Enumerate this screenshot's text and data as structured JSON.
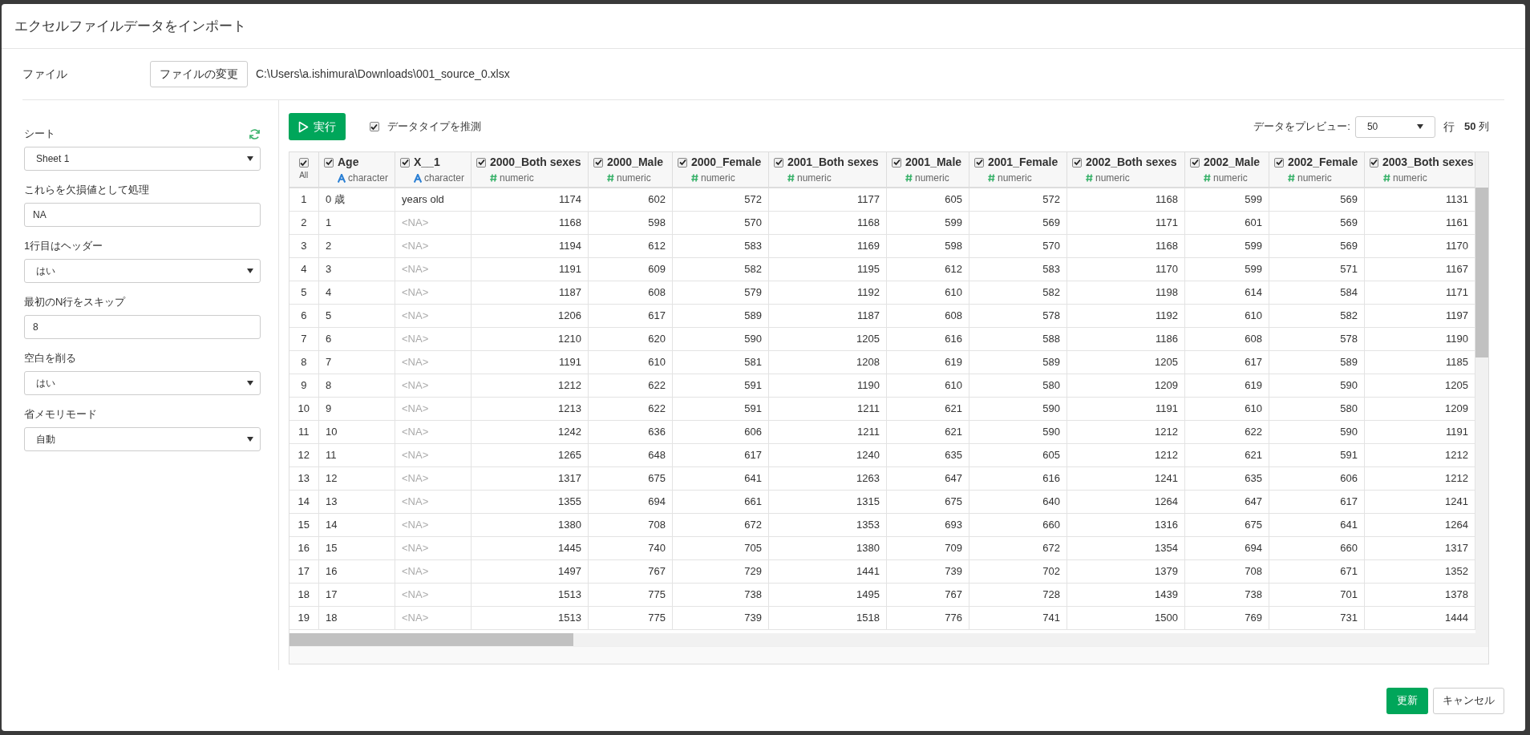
{
  "dialog": {
    "title": "エクセルファイルデータをインポート"
  },
  "file": {
    "label": "ファイル",
    "button": "ファイルの変更",
    "path": "C:\\Users\\a.ishimura\\Downloads\\001_source_0.xlsx"
  },
  "options": [
    {
      "kind": "select",
      "label": "シート",
      "value": "Sheet 1",
      "refresh": true
    },
    {
      "kind": "input",
      "label": "これらを欠損値として処理",
      "value": "NA"
    },
    {
      "kind": "select",
      "label": "1行目はヘッダー",
      "value": "はい"
    },
    {
      "kind": "input",
      "label": "最初のN行をスキップ",
      "value": "8"
    },
    {
      "kind": "select",
      "label": "空白を削る",
      "value": "はい"
    },
    {
      "kind": "select",
      "label": "省メモリモード",
      "value": "自動"
    }
  ],
  "toolbar": {
    "run_button": "実行",
    "guess_types": {
      "label": "データタイプを推測",
      "checked": true
    },
    "preview_label": "データをプレビュー:",
    "preview_value": "50",
    "rows_unit": "行",
    "columns_count": "**50** 列"
  },
  "table": {
    "all": {
      "label": "All",
      "checked": true
    },
    "columns": [
      {
        "name": "Age",
        "type": "character",
        "checked": true
      },
      {
        "name": "X__1",
        "type": "character",
        "checked": true
      },
      {
        "name": "2000_Both sexes",
        "type": "numeric",
        "checked": true
      },
      {
        "name": "2000_Male",
        "type": "numeric",
        "checked": true
      },
      {
        "name": "2000_Female",
        "type": "numeric",
        "checked": true
      },
      {
        "name": "2001_Both sexes",
        "type": "numeric",
        "checked": true
      },
      {
        "name": "2001_Male",
        "type": "numeric",
        "checked": true
      },
      {
        "name": "2001_Female",
        "type": "numeric",
        "checked": true
      },
      {
        "name": "2002_Both sexes",
        "type": "numeric",
        "checked": true
      },
      {
        "name": "2002_Male",
        "type": "numeric",
        "checked": true
      },
      {
        "name": "2002_Female",
        "type": "numeric",
        "checked": true
      },
      {
        "name": "2003_Both sexes",
        "type": "numeric",
        "checked": true
      }
    ],
    "rows": [
      {
        "n": "1",
        "cells": [
          "0 歳",
          "years old",
          "1174",
          "602",
          "572",
          "1177",
          "605",
          "572",
          "1168",
          "599",
          "569",
          "1131"
        ]
      },
      {
        "n": "2",
        "cells": [
          "1",
          {
            "text": "<NA>",
            "missing": true
          },
          "1168",
          "598",
          "570",
          "1168",
          "599",
          "569",
          "1171",
          "601",
          "569",
          "1161"
        ]
      },
      {
        "n": "3",
        "cells": [
          "2",
          {
            "text": "<NA>",
            "missing": true
          },
          "1194",
          "612",
          "583",
          "1169",
          "598",
          "570",
          "1168",
          "599",
          "569",
          "1170"
        ]
      },
      {
        "n": "4",
        "cells": [
          "3",
          {
            "text": "<NA>",
            "missing": true
          },
          "1191",
          "609",
          "582",
          "1195",
          "612",
          "583",
          "1170",
          "599",
          "571",
          "1167"
        ]
      },
      {
        "n": "5",
        "cells": [
          "4",
          {
            "text": "<NA>",
            "missing": true
          },
          "1187",
          "608",
          "579",
          "1192",
          "610",
          "582",
          "1198",
          "614",
          "584",
          "1171"
        ]
      },
      {
        "n": "6",
        "cells": [
          "5",
          {
            "text": "<NA>",
            "missing": true
          },
          "1206",
          "617",
          "589",
          "1187",
          "608",
          "578",
          "1192",
          "610",
          "582",
          "1197"
        ]
      },
      {
        "n": "7",
        "cells": [
          "6",
          {
            "text": "<NA>",
            "missing": true
          },
          "1210",
          "620",
          "590",
          "1205",
          "616",
          "588",
          "1186",
          "608",
          "578",
          "1190"
        ]
      },
      {
        "n": "8",
        "cells": [
          "7",
          {
            "text": "<NA>",
            "missing": true
          },
          "1191",
          "610",
          "581",
          "1208",
          "619",
          "589",
          "1205",
          "617",
          "589",
          "1185"
        ]
      },
      {
        "n": "9",
        "cells": [
          "8",
          {
            "text": "<NA>",
            "missing": true
          },
          "1212",
          "622",
          "591",
          "1190",
          "610",
          "580",
          "1209",
          "619",
          "590",
          "1205"
        ]
      },
      {
        "n": "10",
        "cells": [
          "9",
          {
            "text": "<NA>",
            "missing": true
          },
          "1213",
          "622",
          "591",
          "1211",
          "621",
          "590",
          "1191",
          "610",
          "580",
          "1209"
        ]
      },
      {
        "n": "11",
        "cells": [
          "10",
          {
            "text": "<NA>",
            "missing": true
          },
          "1242",
          "636",
          "606",
          "1211",
          "621",
          "590",
          "1212",
          "622",
          "590",
          "1191"
        ]
      },
      {
        "n": "12",
        "cells": [
          "11",
          {
            "text": "<NA>",
            "missing": true
          },
          "1265",
          "648",
          "617",
          "1240",
          "635",
          "605",
          "1212",
          "621",
          "591",
          "1212"
        ]
      },
      {
        "n": "13",
        "cells": [
          "12",
          {
            "text": "<NA>",
            "missing": true
          },
          "1317",
          "675",
          "641",
          "1263",
          "647",
          "616",
          "1241",
          "635",
          "606",
          "1212"
        ]
      },
      {
        "n": "14",
        "cells": [
          "13",
          {
            "text": "<NA>",
            "missing": true
          },
          "1355",
          "694",
          "661",
          "1315",
          "675",
          "640",
          "1264",
          "647",
          "617",
          "1241"
        ]
      },
      {
        "n": "15",
        "cells": [
          "14",
          {
            "text": "<NA>",
            "missing": true
          },
          "1380",
          "708",
          "672",
          "1353",
          "693",
          "660",
          "1316",
          "675",
          "641",
          "1264"
        ]
      },
      {
        "n": "16",
        "cells": [
          "15",
          {
            "text": "<NA>",
            "missing": true
          },
          "1445",
          "740",
          "705",
          "1380",
          "709",
          "672",
          "1354",
          "694",
          "660",
          "1317"
        ]
      },
      {
        "n": "17",
        "cells": [
          "16",
          {
            "text": "<NA>",
            "missing": true
          },
          "1497",
          "767",
          "729",
          "1441",
          "739",
          "702",
          "1379",
          "708",
          "671",
          "1352"
        ]
      },
      {
        "n": "18",
        "cells": [
          "17",
          {
            "text": "<NA>",
            "missing": true
          },
          "1513",
          "775",
          "738",
          "1495",
          "767",
          "728",
          "1439",
          "738",
          "701",
          "1378"
        ]
      },
      {
        "n": "19",
        "cells": [
          "18",
          {
            "text": "<NA>",
            "missing": true
          },
          "1513",
          "775",
          "739",
          "1518",
          "776",
          "741",
          "1500",
          "769",
          "731",
          "1444"
        ]
      }
    ]
  },
  "footer": {
    "update_button": "更新",
    "cancel_button": "キャンセル"
  }
}
